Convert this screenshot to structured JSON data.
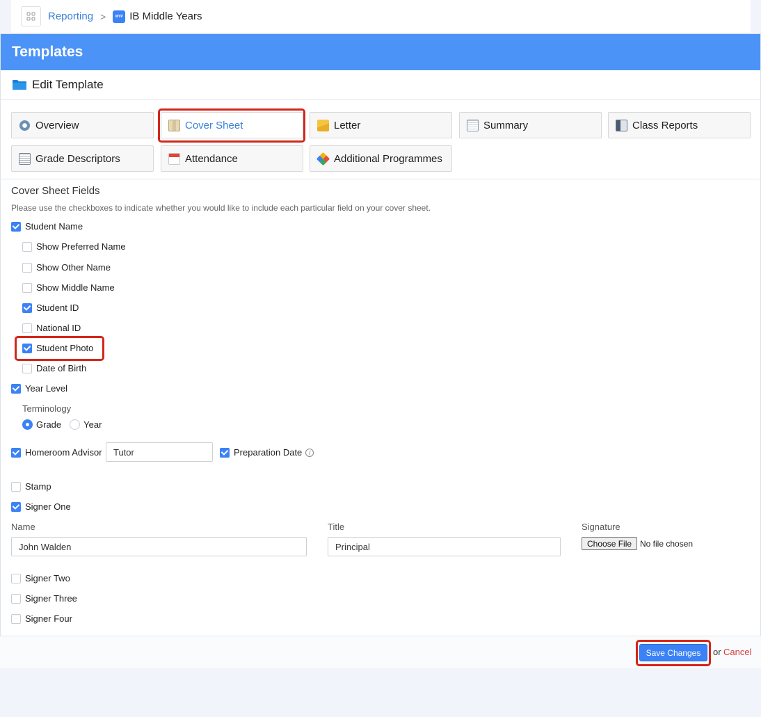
{
  "breadcrumb": {
    "parent": "Reporting",
    "separator": ">",
    "current": "IB Middle Years",
    "logo_text": "MYP"
  },
  "header": {
    "title": "Templates"
  },
  "subheader": {
    "title": "Edit Template"
  },
  "tabs": [
    {
      "label": "Overview",
      "icon": "gear-icon",
      "active": false
    },
    {
      "label": "Cover Sheet",
      "icon": "map-icon",
      "active": true
    },
    {
      "label": "Letter",
      "icon": "envelope-icon",
      "active": false
    },
    {
      "label": "Summary",
      "icon": "clipboard-icon",
      "active": false
    },
    {
      "label": "Class Reports",
      "icon": "id-card-icon",
      "active": false
    },
    {
      "label": "Grade Descriptors",
      "icon": "document-icon",
      "active": false
    },
    {
      "label": "Attendance",
      "icon": "calendar-icon",
      "active": false
    },
    {
      "label": "Additional Programmes",
      "icon": "puzzle-icon",
      "active": false
    }
  ],
  "section": {
    "title": "Cover Sheet Fields",
    "help": "Please use the checkboxes to indicate whether you would like to include each particular field on your cover sheet."
  },
  "fields": {
    "student_name": {
      "label": "Student Name",
      "checked": true
    },
    "show_preferred_name": {
      "label": "Show Preferred Name",
      "checked": false
    },
    "show_other_name": {
      "label": "Show Other Name",
      "checked": false
    },
    "show_middle_name": {
      "label": "Show Middle Name",
      "checked": false
    },
    "student_id": {
      "label": "Student ID",
      "checked": true
    },
    "national_id": {
      "label": "National ID",
      "checked": false
    },
    "student_photo": {
      "label": "Student Photo",
      "checked": true
    },
    "date_of_birth": {
      "label": "Date of Birth",
      "checked": false
    },
    "year_level": {
      "label": "Year Level",
      "checked": true
    },
    "homeroom_advisor": {
      "label": "Homeroom Advisor",
      "checked": true,
      "value": "Tutor"
    },
    "preparation_date": {
      "label": "Preparation Date",
      "checked": true,
      "info": "i"
    },
    "stamp": {
      "label": "Stamp",
      "checked": false
    },
    "signer_one": {
      "label": "Signer One",
      "checked": true
    },
    "signer_two": {
      "label": "Signer Two",
      "checked": false
    },
    "signer_three": {
      "label": "Signer Three",
      "checked": false
    },
    "signer_four": {
      "label": "Signer Four",
      "checked": false
    }
  },
  "terminology": {
    "label": "Terminology",
    "options": [
      {
        "label": "Grade",
        "selected": true
      },
      {
        "label": "Year",
        "selected": false
      }
    ]
  },
  "signer": {
    "name_label": "Name",
    "name_value": "John Walden",
    "title_label": "Title",
    "title_value": "Principal",
    "signature_label": "Signature",
    "file_button": "Choose File",
    "file_status": "No file chosen"
  },
  "footer": {
    "save": "Save Changes",
    "or": "or",
    "cancel": "Cancel"
  },
  "colors": {
    "accent": "#3b82f6",
    "header": "#4c93f7",
    "highlight": "#d3261a",
    "cancel": "#d93a3a"
  }
}
